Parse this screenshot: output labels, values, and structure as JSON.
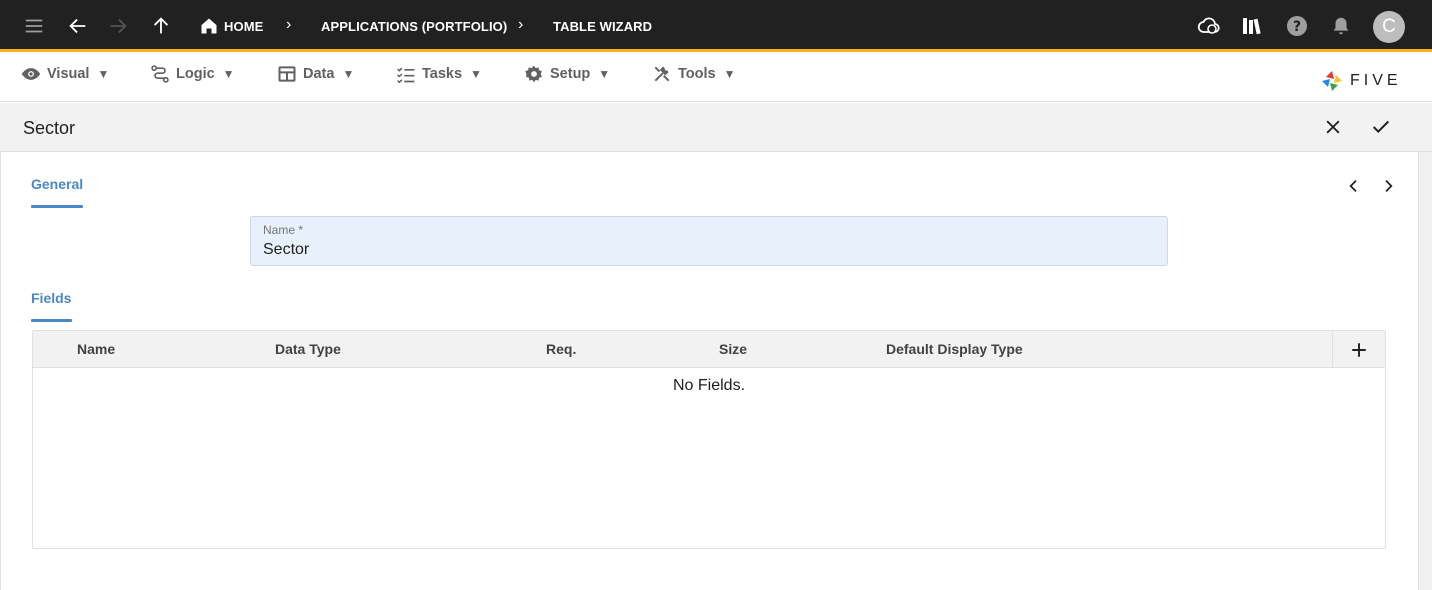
{
  "topbar": {
    "breadcrumbs": [
      "HOME",
      "APPLICATIONS (PORTFOLIO)",
      "TABLE WIZARD"
    ],
    "avatar_initial": "C"
  },
  "menu": {
    "items": [
      {
        "label": "Visual",
        "icon": "eye-icon"
      },
      {
        "label": "Logic",
        "icon": "flow-icon"
      },
      {
        "label": "Data",
        "icon": "table-icon"
      },
      {
        "label": "Tasks",
        "icon": "checklist-icon"
      },
      {
        "label": "Setup",
        "icon": "gear-icon"
      },
      {
        "label": "Tools",
        "icon": "tools-icon"
      }
    ],
    "caret": "▼",
    "logo_text": "FIVE"
  },
  "form": {
    "title": "Sector",
    "general_tab": "General",
    "name_label": "Name *",
    "name_value": "Sector",
    "fields_tab": "Fields"
  },
  "grid": {
    "columns": [
      "Name",
      "Data Type",
      "Req.",
      "Size",
      "Default Display Type"
    ],
    "empty_text": "No Fields."
  },
  "colors": {
    "topbar": "#212121",
    "accent_bar": "#f5b21b",
    "tab_blue": "#4a88c7",
    "field_bg": "#e8f1fb"
  }
}
